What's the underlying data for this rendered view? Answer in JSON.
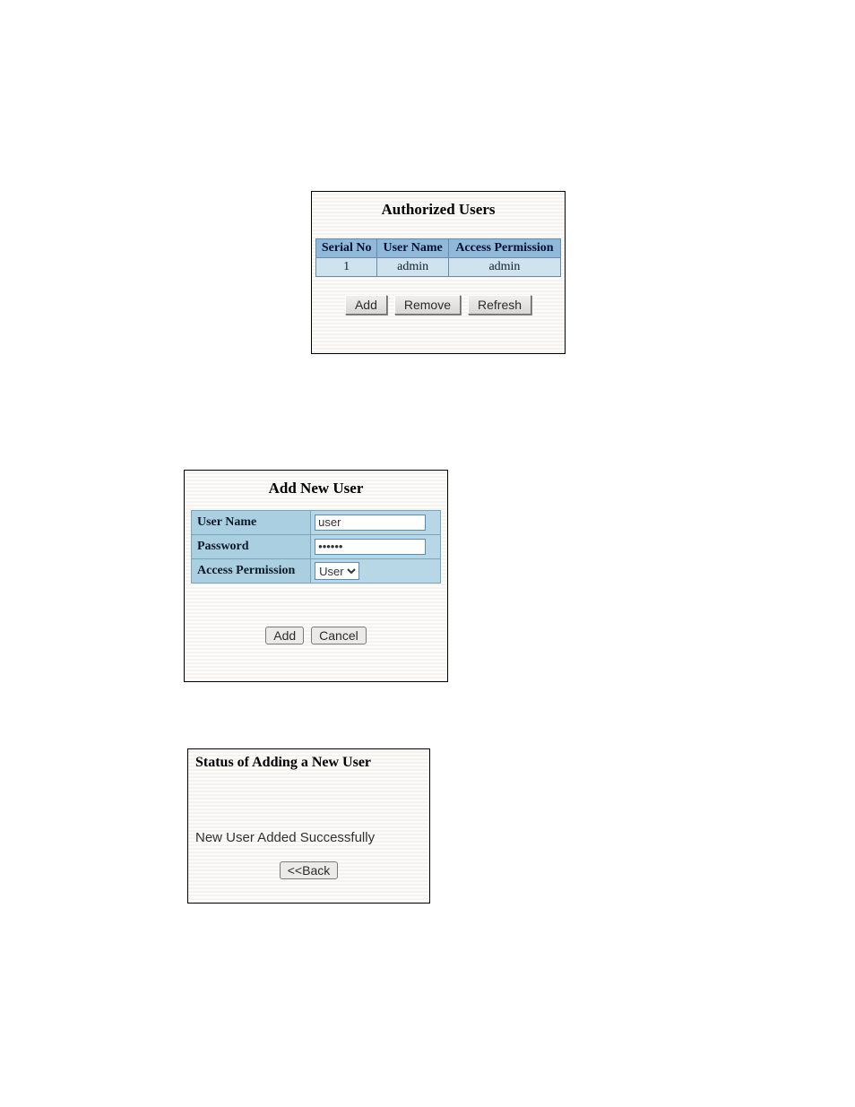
{
  "auth": {
    "title": "Authorized Users",
    "headers": {
      "serial": "Serial No",
      "user": "User Name",
      "perm": "Access Permission"
    },
    "rows": [
      {
        "serial": "1",
        "user": "admin",
        "perm": "admin"
      }
    ],
    "buttons": {
      "add": "Add",
      "remove": "Remove",
      "refresh": "Refresh"
    }
  },
  "add_user": {
    "title": "Add New User",
    "labels": {
      "user": "User Name",
      "password": "Password",
      "perm": "Access Permission"
    },
    "values": {
      "user": "user",
      "password_display": "••••••",
      "perm_selected": "User"
    },
    "buttons": {
      "add": "Add",
      "cancel": "Cancel"
    }
  },
  "status": {
    "title": "Status of Adding a New User",
    "message": "New User Added Successfully",
    "back_label": "<<Back"
  }
}
